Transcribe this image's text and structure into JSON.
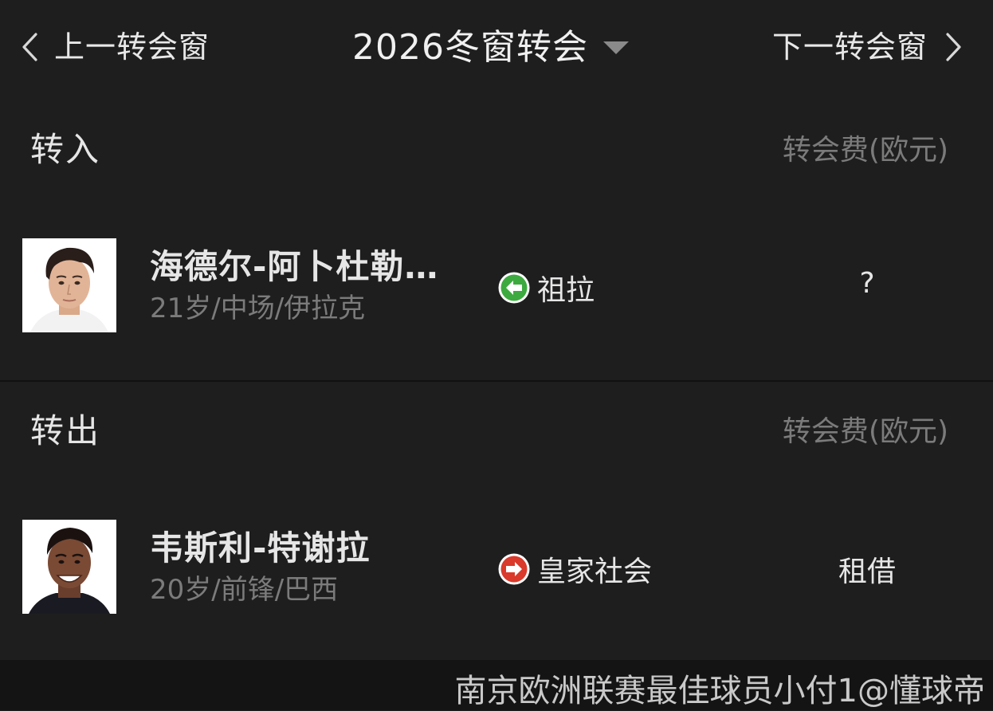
{
  "header": {
    "prev_label": "上一转会窗",
    "window_title": "2026冬窗转会",
    "next_label": "下一转会窗"
  },
  "transfers_in": {
    "title": "转入",
    "fee_header": "转会费(欧元)",
    "players": [
      {
        "name": "海德尔-阿卜杜勒…",
        "info": "21岁/中场/伊拉克",
        "club": "祖拉",
        "direction_icon": "arrow-left-icon",
        "fee": "?"
      }
    ]
  },
  "transfers_out": {
    "title": "转出",
    "fee_header": "转会费(欧元)",
    "players": [
      {
        "name": "韦斯利-特谢拉",
        "info": "20岁/前锋/巴西",
        "club": "皇家社会",
        "direction_icon": "arrow-right-icon",
        "fee": "租借"
      }
    ]
  },
  "watermark": "南京欧洲联赛最佳球员小付1@懂球帝",
  "colors": {
    "background": "#1e1e1f",
    "in_arrow": "#3daa3f",
    "out_arrow": "#d93a2b",
    "muted_text": "#7b7b7b"
  }
}
